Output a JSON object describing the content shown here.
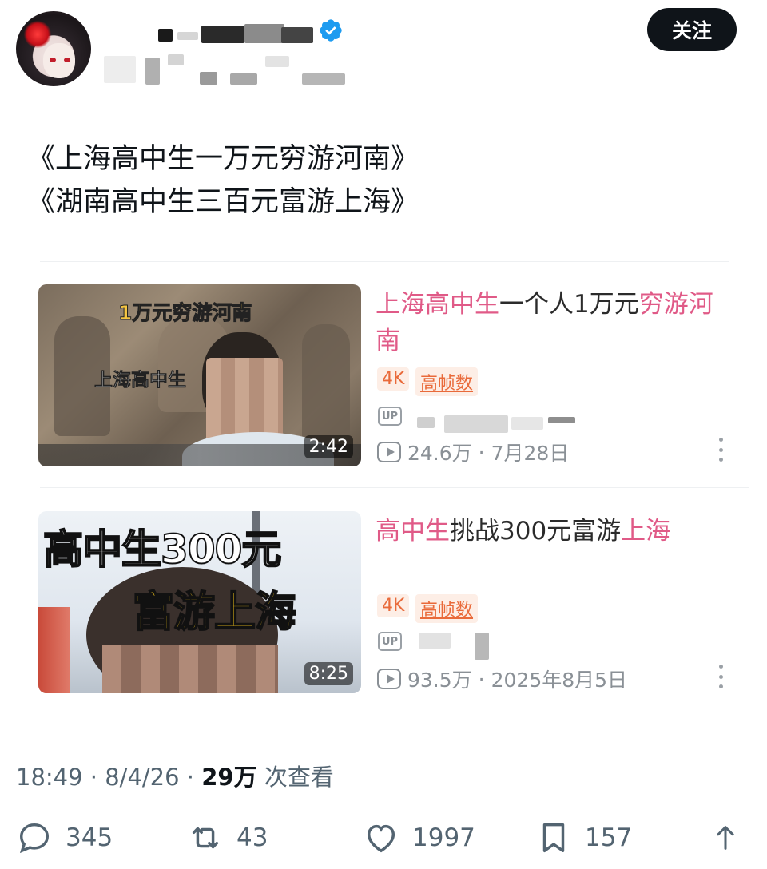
{
  "header": {
    "follow_label": "关注",
    "avatar_icon": "anime-avatar-icon",
    "verified_icon": "verified-badge-icon",
    "verified_color": "#1d9bf0"
  },
  "post": {
    "line1": "《上海高中生一万元穷游河南》",
    "line2": "《湖南高中生三百元富游上海》"
  },
  "videos": [
    {
      "thumb_caption_top": "1万元穷游河南",
      "thumb_caption_side": "上海高中生",
      "duration": "2:42",
      "title_parts": [
        "上海高中生",
        "一个人1万元",
        "穷游",
        "河南"
      ],
      "tags": [
        "4K",
        "高帧数"
      ],
      "up_label": "UP",
      "views": "24.6万",
      "separator": "·",
      "date": "7月28日"
    },
    {
      "thumb_caption_top": "高中生300元",
      "thumb_caption_bottom": "富游上海",
      "duration": "8:25",
      "title_parts": [
        "高中生",
        "挑战300元富游",
        "上海"
      ],
      "tags": [
        "4K",
        "高帧数"
      ],
      "up_label": "UP",
      "views": "93.5万",
      "separator": "·",
      "date": "2025年8月5日"
    }
  ],
  "meta": {
    "time": "18:49",
    "separator": "·",
    "date": "8/4/26",
    "views_count": "29万",
    "views_label": "次查看"
  },
  "actions": {
    "replies": "345",
    "reposts": "43",
    "likes": "1997",
    "bookmarks": "157"
  },
  "colors": {
    "highlight_pink": "#e05a87",
    "tag_orange": "#e96a3a",
    "meta_gray": "#536471"
  }
}
